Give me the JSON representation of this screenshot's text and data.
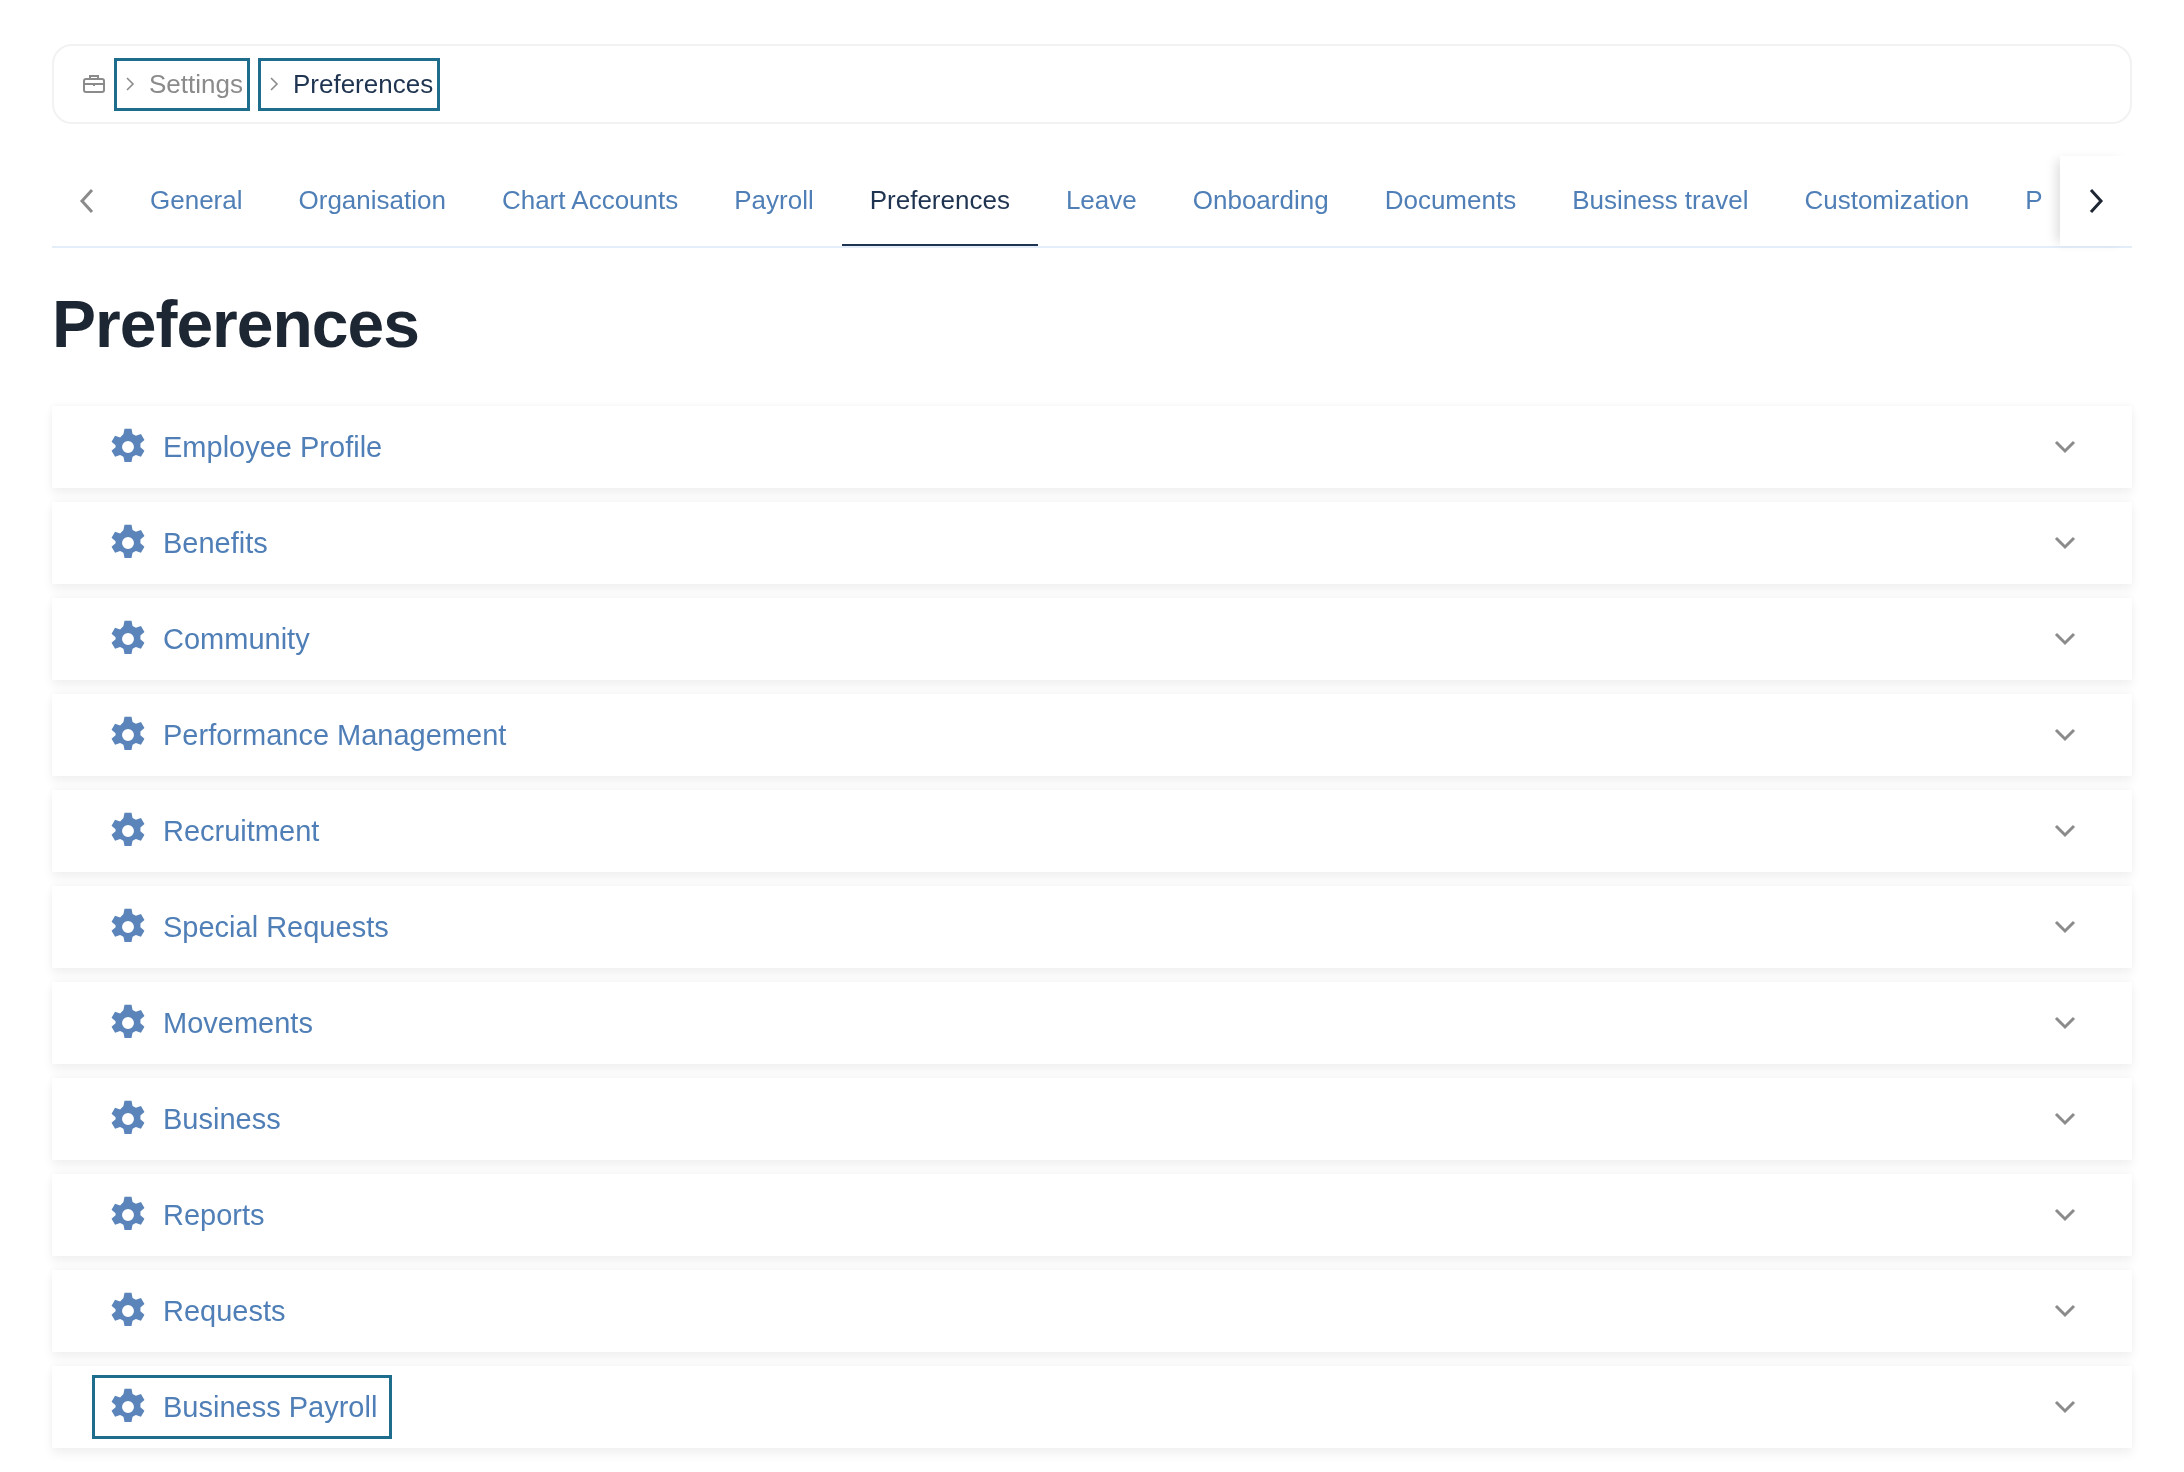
{
  "breadcrumb": [
    {
      "label": "Settings",
      "current": false,
      "focused": true
    },
    {
      "label": "Preferences",
      "current": true,
      "focused": true
    }
  ],
  "tabs": [
    {
      "label": "General",
      "selected": false
    },
    {
      "label": "Organisation",
      "selected": false
    },
    {
      "label": "Chart Accounts",
      "selected": false
    },
    {
      "label": "Payroll",
      "selected": false
    },
    {
      "label": "Preferences",
      "selected": true
    },
    {
      "label": "Leave",
      "selected": false
    },
    {
      "label": "Onboarding",
      "selected": false
    },
    {
      "label": "Documents",
      "selected": false
    },
    {
      "label": "Business travel",
      "selected": false
    },
    {
      "label": "Customization",
      "selected": false
    },
    {
      "label": "P",
      "selected": false
    }
  ],
  "page_title": "Preferences",
  "sections": [
    {
      "label": "Employee Profile",
      "expanded": false,
      "focused": false
    },
    {
      "label": "Benefits",
      "expanded": false,
      "focused": false
    },
    {
      "label": "Community",
      "expanded": false,
      "focused": false
    },
    {
      "label": "Performance Management",
      "expanded": false,
      "focused": false
    },
    {
      "label": "Recruitment",
      "expanded": false,
      "focused": false
    },
    {
      "label": "Special Requests",
      "expanded": false,
      "focused": false
    },
    {
      "label": "Movements",
      "expanded": false,
      "focused": false
    },
    {
      "label": "Business",
      "expanded": false,
      "focused": false
    },
    {
      "label": "Reports",
      "expanded": false,
      "focused": false
    },
    {
      "label": "Requests",
      "expanded": false,
      "focused": false
    },
    {
      "label": "Business Payroll",
      "expanded": false,
      "focused": true
    }
  ]
}
